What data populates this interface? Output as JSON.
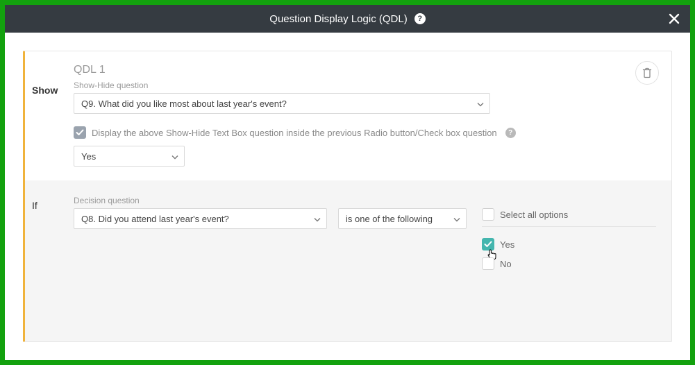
{
  "header": {
    "title": "Question Display Logic (QDL)"
  },
  "qdl": {
    "title": "QDL 1",
    "show": {
      "section_label": "Show-Hide question",
      "row_label": "Show",
      "question": "Q9. What did you like most about last year's event?",
      "inline_note": "Display the above Show-Hide Text Box question inside the previous Radio button/Check box question",
      "inline_value": "Yes"
    },
    "if": {
      "section_label": "Decision question",
      "row_label": "If",
      "question": "Q8. Did you attend last year's event?",
      "condition": "is one of the following",
      "select_all_label": "Select all options",
      "options": [
        {
          "label": "Yes",
          "checked": true
        },
        {
          "label": "No",
          "checked": false
        }
      ]
    }
  }
}
